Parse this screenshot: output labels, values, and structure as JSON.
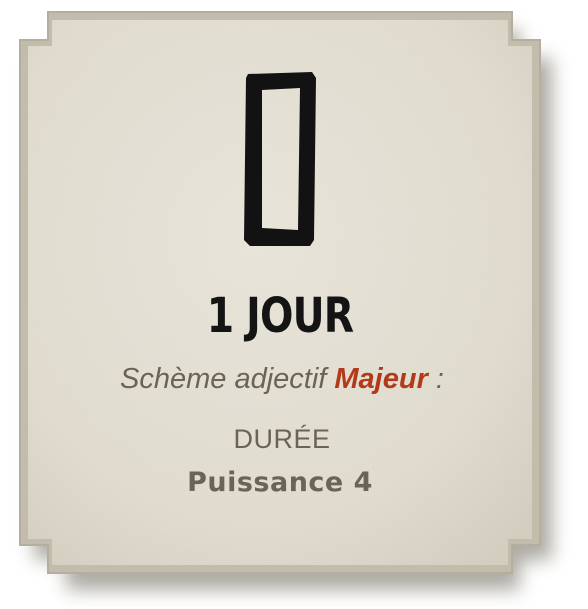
{
  "card": {
    "title": "1 JOUR",
    "subtitle_prefix": "Schème adjectif",
    "subtitle_keyword": "Majeur",
    "subtitle_suffix": " :",
    "category": "DURÉE",
    "power": "Puissance 4",
    "glyph": "rectangle-rune-icon"
  },
  "colors": {
    "paper": "#ddd8cb",
    "paper_dark": "#c7c1b1",
    "border": "#bdb6a6",
    "ink": "#141414",
    "text_muted": "#6a6457",
    "accent": "#b3391b"
  }
}
